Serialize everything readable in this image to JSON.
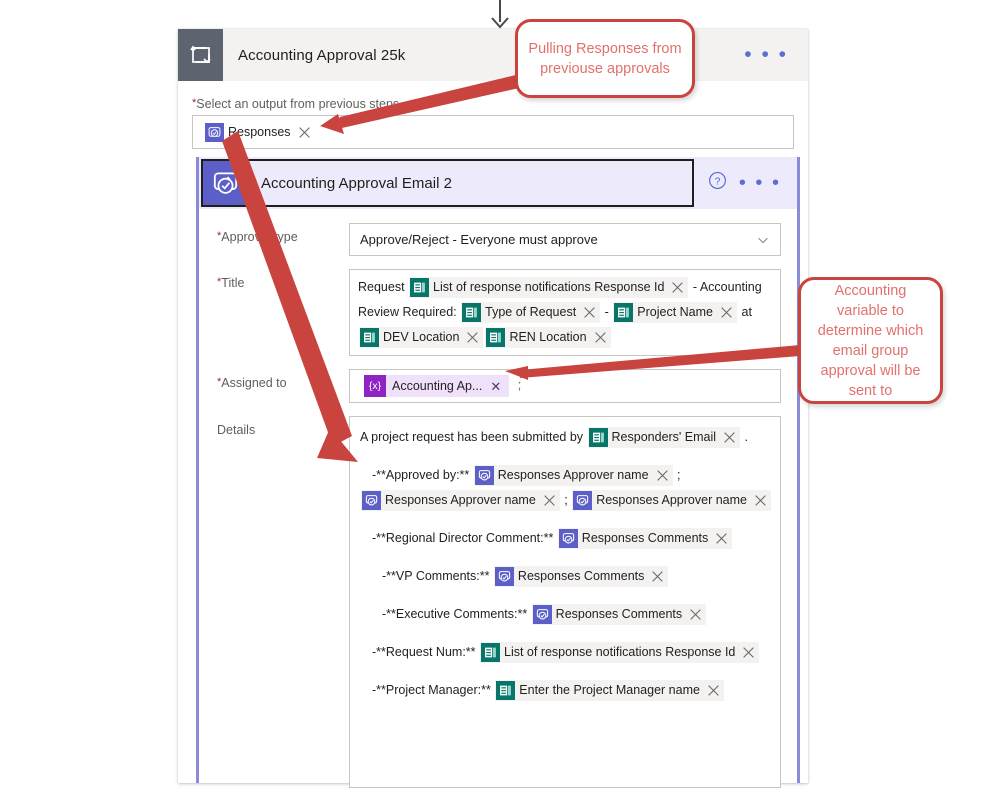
{
  "flow": {
    "connector_arrow_icon": "arrow-down-icon"
  },
  "outer_card": {
    "icon": "apply-to-each-loop-icon",
    "title": "Accounting Approval 25k",
    "overflow_menu": "• • •",
    "output_field": {
      "label": "Select an output from previous steps",
      "required_marker": "*",
      "token": {
        "icon": "approvals-icon",
        "text": "Responses",
        "remove_icon": "close-icon"
      }
    }
  },
  "inner_card": {
    "icon": "approvals-icon",
    "title": "Accounting Approval Email 2",
    "help_icon": "help-circle-icon",
    "overflow_menu": "• • •",
    "fields": {
      "approval_type": {
        "label": "Approval type",
        "required_marker": "*",
        "value": "Approve/Reject - Everyone must approve",
        "chevron_icon": "chevron-down-icon"
      },
      "title": {
        "label": "Title",
        "required_marker": "*",
        "lines": [
          [
            {
              "kind": "text",
              "value": "Request"
            },
            {
              "kind": "token",
              "icon": "forms-icon",
              "text": "List of response notifications Response Id"
            },
            {
              "kind": "text",
              "value": "- Accounting"
            }
          ],
          [
            {
              "kind": "text",
              "value": "Review Required:"
            },
            {
              "kind": "token",
              "icon": "forms-icon",
              "text": "Type of Request"
            },
            {
              "kind": "text",
              "value": "-"
            },
            {
              "kind": "token",
              "icon": "forms-icon",
              "text": "Project Name"
            },
            {
              "kind": "text",
              "value": "at"
            }
          ],
          [
            {
              "kind": "token",
              "icon": "forms-icon",
              "text": "DEV Location"
            },
            {
              "kind": "token",
              "icon": "forms-icon",
              "text": "REN Location"
            }
          ]
        ]
      },
      "assigned_to": {
        "label": "Assigned to",
        "required_marker": "*",
        "variable_token": {
          "icon": "variable-icon",
          "icon_glyph": "{x}",
          "text": "Accounting Ap...",
          "remove_icon": "close-icon"
        },
        "trailing_text": ";"
      },
      "details": {
        "label": "Details",
        "lines": [
          {
            "indent": 0,
            "parts": [
              {
                "kind": "text",
                "value": "A project request has been submitted by"
              },
              {
                "kind": "token",
                "icon": "forms-icon",
                "text": "Responders' Email"
              },
              {
                "kind": "text",
                "value": "."
              }
            ]
          },
          {
            "indent": 0,
            "parts": []
          },
          {
            "indent": 1,
            "parts": [
              {
                "kind": "text",
                "value": "-**Approved by:**"
              },
              {
                "kind": "token",
                "icon": "approvals-icon",
                "text": "Responses Approver name"
              },
              {
                "kind": "text",
                "value": ";"
              }
            ]
          },
          {
            "indent": 0,
            "parts": [
              {
                "kind": "token",
                "icon": "approvals-icon",
                "text": "Responses Approver name"
              },
              {
                "kind": "text",
                "value": ";"
              },
              {
                "kind": "token",
                "icon": "approvals-icon",
                "text": "Responses Approver name"
              }
            ]
          },
          {
            "indent": 0,
            "parts": []
          },
          {
            "indent": 1,
            "parts": [
              {
                "kind": "text",
                "value": "-**Regional Director Comment:**"
              },
              {
                "kind": "token",
                "icon": "approvals-icon",
                "text": "Responses Comments"
              }
            ]
          },
          {
            "indent": 0,
            "parts": []
          },
          {
            "indent": 2,
            "parts": [
              {
                "kind": "text",
                "value": "-**VP Comments:**"
              },
              {
                "kind": "token",
                "icon": "approvals-icon",
                "text": "Responses Comments"
              }
            ]
          },
          {
            "indent": 0,
            "parts": []
          },
          {
            "indent": 2,
            "parts": [
              {
                "kind": "text",
                "value": "-**Executive Comments:**"
              },
              {
                "kind": "token",
                "icon": "approvals-icon",
                "text": "Responses Comments"
              }
            ]
          },
          {
            "indent": 0,
            "parts": []
          },
          {
            "indent": 1,
            "parts": [
              {
                "kind": "text",
                "value": "-**Request Num:**"
              },
              {
                "kind": "token",
                "icon": "forms-icon",
                "text": "List of response notifications Response Id"
              }
            ]
          },
          {
            "indent": 0,
            "parts": []
          },
          {
            "indent": 1,
            "parts": [
              {
                "kind": "text",
                "value": "-**Project Manager:**"
              },
              {
                "kind": "token",
                "icon": "forms-icon",
                "text": "Enter the Project Manager name"
              }
            ]
          }
        ]
      }
    }
  },
  "annotations": [
    {
      "id": "callout-responses",
      "text": "Pulling Responses from previouse approvals"
    },
    {
      "id": "callout-variable",
      "text": "Accounting variable to determine which email group approval will be sent to"
    }
  ],
  "colors": {
    "callout_border": "#c9443e",
    "callout_text": "#e2716c",
    "approvals_icon_bg": "#5b5fc7",
    "forms_icon_bg": "#077568",
    "variable_icon_bg": "#8f24c4",
    "outer_icon_bg": "#5d6470",
    "inner_header_bg": "#eceafb",
    "inner_card_border": "#8b8cd8",
    "required_marker": "#a4262c"
  }
}
